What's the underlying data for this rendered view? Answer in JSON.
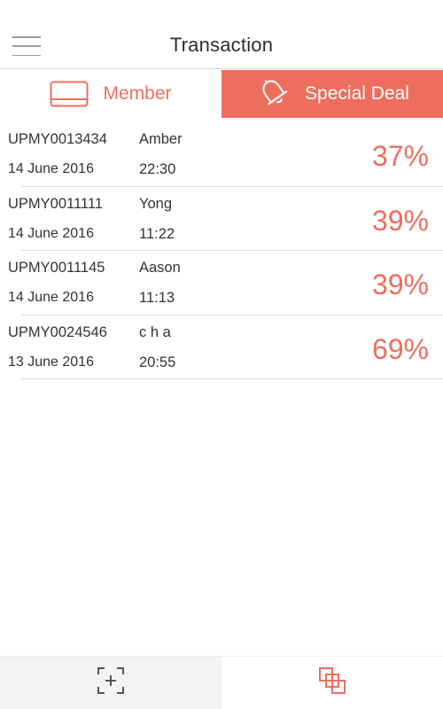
{
  "header": {
    "title": "Transaction",
    "menu_icon": "hamburger-menu-icon"
  },
  "tabs": [
    {
      "label": "Member",
      "icon": "card-icon",
      "active": false
    },
    {
      "label": "Special Deal",
      "icon": "bell-icon",
      "active": true
    }
  ],
  "colors": {
    "accent": "#ee6e5d",
    "divider": "#dcdcdc",
    "bottom_left_bg": "#f3f3f3"
  },
  "transactions": [
    {
      "code": "UPMY0013434",
      "name": "Amber",
      "date": "14 June 2016",
      "time": "22:30",
      "percent": "37%"
    },
    {
      "code": "UPMY0011111",
      "name": "Yong",
      "date": "14 June 2016",
      "time": "11:22",
      "percent": "39%"
    },
    {
      "code": "UPMY0011145",
      "name": "Aason",
      "date": "14 June 2016",
      "time": "11:13",
      "percent": "39%"
    },
    {
      "code": "UPMY0024546",
      "name": "c h a",
      "date": "13 June 2016",
      "time": "20:55",
      "percent": "69%"
    }
  ],
  "bottom_nav": [
    {
      "icon": "scan-add-icon"
    },
    {
      "icon": "overlap-squares-icon"
    }
  ]
}
